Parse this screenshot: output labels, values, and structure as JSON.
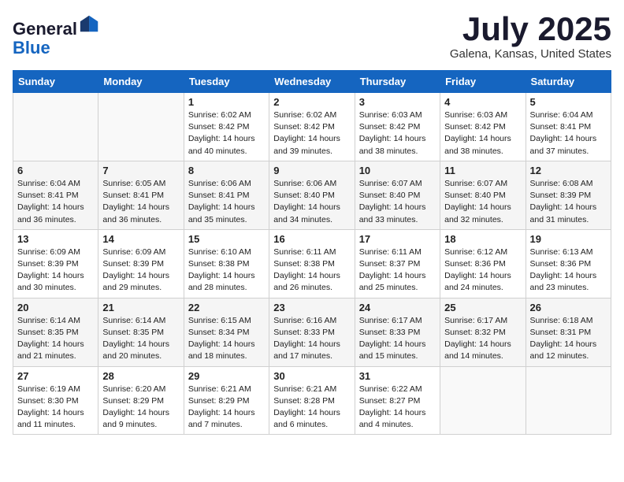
{
  "header": {
    "logo_line1": "General",
    "logo_line2": "Blue",
    "month": "July 2025",
    "location": "Galena, Kansas, United States"
  },
  "weekdays": [
    "Sunday",
    "Monday",
    "Tuesday",
    "Wednesday",
    "Thursday",
    "Friday",
    "Saturday"
  ],
  "weeks": [
    [
      {
        "day": "",
        "info": ""
      },
      {
        "day": "",
        "info": ""
      },
      {
        "day": "1",
        "info": "Sunrise: 6:02 AM\nSunset: 8:42 PM\nDaylight: 14 hours\nand 40 minutes."
      },
      {
        "day": "2",
        "info": "Sunrise: 6:02 AM\nSunset: 8:42 PM\nDaylight: 14 hours\nand 39 minutes."
      },
      {
        "day": "3",
        "info": "Sunrise: 6:03 AM\nSunset: 8:42 PM\nDaylight: 14 hours\nand 38 minutes."
      },
      {
        "day": "4",
        "info": "Sunrise: 6:03 AM\nSunset: 8:42 PM\nDaylight: 14 hours\nand 38 minutes."
      },
      {
        "day": "5",
        "info": "Sunrise: 6:04 AM\nSunset: 8:41 PM\nDaylight: 14 hours\nand 37 minutes."
      }
    ],
    [
      {
        "day": "6",
        "info": "Sunrise: 6:04 AM\nSunset: 8:41 PM\nDaylight: 14 hours\nand 36 minutes."
      },
      {
        "day": "7",
        "info": "Sunrise: 6:05 AM\nSunset: 8:41 PM\nDaylight: 14 hours\nand 36 minutes."
      },
      {
        "day": "8",
        "info": "Sunrise: 6:06 AM\nSunset: 8:41 PM\nDaylight: 14 hours\nand 35 minutes."
      },
      {
        "day": "9",
        "info": "Sunrise: 6:06 AM\nSunset: 8:40 PM\nDaylight: 14 hours\nand 34 minutes."
      },
      {
        "day": "10",
        "info": "Sunrise: 6:07 AM\nSunset: 8:40 PM\nDaylight: 14 hours\nand 33 minutes."
      },
      {
        "day": "11",
        "info": "Sunrise: 6:07 AM\nSunset: 8:40 PM\nDaylight: 14 hours\nand 32 minutes."
      },
      {
        "day": "12",
        "info": "Sunrise: 6:08 AM\nSunset: 8:39 PM\nDaylight: 14 hours\nand 31 minutes."
      }
    ],
    [
      {
        "day": "13",
        "info": "Sunrise: 6:09 AM\nSunset: 8:39 PM\nDaylight: 14 hours\nand 30 minutes."
      },
      {
        "day": "14",
        "info": "Sunrise: 6:09 AM\nSunset: 8:39 PM\nDaylight: 14 hours\nand 29 minutes."
      },
      {
        "day": "15",
        "info": "Sunrise: 6:10 AM\nSunset: 8:38 PM\nDaylight: 14 hours\nand 28 minutes."
      },
      {
        "day": "16",
        "info": "Sunrise: 6:11 AM\nSunset: 8:38 PM\nDaylight: 14 hours\nand 26 minutes."
      },
      {
        "day": "17",
        "info": "Sunrise: 6:11 AM\nSunset: 8:37 PM\nDaylight: 14 hours\nand 25 minutes."
      },
      {
        "day": "18",
        "info": "Sunrise: 6:12 AM\nSunset: 8:36 PM\nDaylight: 14 hours\nand 24 minutes."
      },
      {
        "day": "19",
        "info": "Sunrise: 6:13 AM\nSunset: 8:36 PM\nDaylight: 14 hours\nand 23 minutes."
      }
    ],
    [
      {
        "day": "20",
        "info": "Sunrise: 6:14 AM\nSunset: 8:35 PM\nDaylight: 14 hours\nand 21 minutes."
      },
      {
        "day": "21",
        "info": "Sunrise: 6:14 AM\nSunset: 8:35 PM\nDaylight: 14 hours\nand 20 minutes."
      },
      {
        "day": "22",
        "info": "Sunrise: 6:15 AM\nSunset: 8:34 PM\nDaylight: 14 hours\nand 18 minutes."
      },
      {
        "day": "23",
        "info": "Sunrise: 6:16 AM\nSunset: 8:33 PM\nDaylight: 14 hours\nand 17 minutes."
      },
      {
        "day": "24",
        "info": "Sunrise: 6:17 AM\nSunset: 8:33 PM\nDaylight: 14 hours\nand 15 minutes."
      },
      {
        "day": "25",
        "info": "Sunrise: 6:17 AM\nSunset: 8:32 PM\nDaylight: 14 hours\nand 14 minutes."
      },
      {
        "day": "26",
        "info": "Sunrise: 6:18 AM\nSunset: 8:31 PM\nDaylight: 14 hours\nand 12 minutes."
      }
    ],
    [
      {
        "day": "27",
        "info": "Sunrise: 6:19 AM\nSunset: 8:30 PM\nDaylight: 14 hours\nand 11 minutes."
      },
      {
        "day": "28",
        "info": "Sunrise: 6:20 AM\nSunset: 8:29 PM\nDaylight: 14 hours\nand 9 minutes."
      },
      {
        "day": "29",
        "info": "Sunrise: 6:21 AM\nSunset: 8:29 PM\nDaylight: 14 hours\nand 7 minutes."
      },
      {
        "day": "30",
        "info": "Sunrise: 6:21 AM\nSunset: 8:28 PM\nDaylight: 14 hours\nand 6 minutes."
      },
      {
        "day": "31",
        "info": "Sunrise: 6:22 AM\nSunset: 8:27 PM\nDaylight: 14 hours\nand 4 minutes."
      },
      {
        "day": "",
        "info": ""
      },
      {
        "day": "",
        "info": ""
      }
    ]
  ]
}
